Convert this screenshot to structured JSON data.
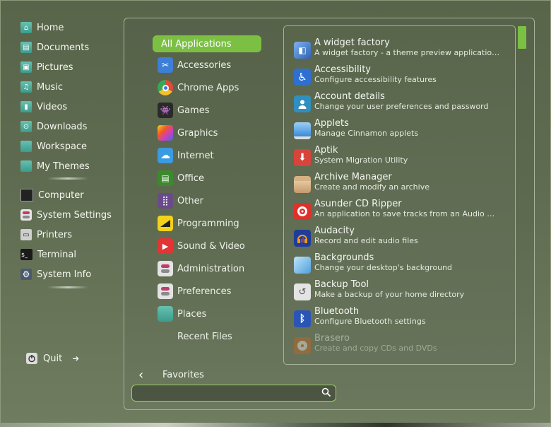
{
  "side": {
    "places": [
      {
        "label": "Home",
        "icon": "home-folder-icon"
      },
      {
        "label": "Documents",
        "icon": "documents-folder-icon"
      },
      {
        "label": "Pictures",
        "icon": "pictures-folder-icon"
      },
      {
        "label": "Music",
        "icon": "music-folder-icon"
      },
      {
        "label": "Videos",
        "icon": "videos-folder-icon"
      },
      {
        "label": "Downloads",
        "icon": "downloads-folder-icon"
      },
      {
        "label": "Workspace",
        "icon": "folder-icon"
      },
      {
        "label": "My Themes",
        "icon": "folder-icon"
      }
    ],
    "system": [
      {
        "label": "Computer",
        "icon": "computer-icon"
      },
      {
        "label": "System Settings",
        "icon": "settings-icon"
      },
      {
        "label": "Printers",
        "icon": "printer-icon"
      },
      {
        "label": "Terminal",
        "icon": "terminal-icon"
      },
      {
        "label": "System Info",
        "icon": "gear-icon"
      }
    ],
    "quit_label": "Quit"
  },
  "categories": [
    {
      "label": "All Applications",
      "active": true
    },
    {
      "label": "Accessories",
      "icon": "scissors-icon",
      "color": "#3d7fd6"
    },
    {
      "label": "Chrome Apps",
      "icon": "chrome-icon",
      "color": "#e04a3a"
    },
    {
      "label": "Games",
      "icon": "gamepad-icon",
      "color": "#2a2a2a"
    },
    {
      "label": "Graphics",
      "icon": "graphics-icon",
      "color": "#c93fbf"
    },
    {
      "label": "Internet",
      "icon": "cloud-icon",
      "color": "#3a9be0"
    },
    {
      "label": "Office",
      "icon": "office-icon",
      "color": "#3c8a2e"
    },
    {
      "label": "Other",
      "icon": "grid-icon",
      "color": "#6a4a8a"
    },
    {
      "label": "Programming",
      "icon": "programming-icon",
      "color": "#f2d21b"
    },
    {
      "label": "Sound & Video",
      "icon": "play-icon",
      "color": "#e23434"
    },
    {
      "label": "Administration",
      "icon": "toggle-icon",
      "color": "#d8d8d8"
    },
    {
      "label": "Preferences",
      "icon": "toggle-icon",
      "color": "#d8d8d8"
    },
    {
      "label": "Places",
      "icon": "folder-icon",
      "color": "#4db3a1"
    },
    {
      "label": "Recent Files"
    }
  ],
  "apps": [
    {
      "name": "A widget factory",
      "desc": "A widget factory - a theme preview applicatio…",
      "icon": "widget-factory-icon",
      "color": "#3b78c7"
    },
    {
      "name": "Accessibility",
      "desc": "Configure accessibility features",
      "icon": "accessibility-icon",
      "color": "#2f6fd0"
    },
    {
      "name": "Account details",
      "desc": "Change your user preferences and password",
      "icon": "user-icon",
      "color": "#2f8fbf"
    },
    {
      "name": "Applets",
      "desc": "Manage Cinnamon applets",
      "icon": "applets-icon",
      "color": "#5ea6e8"
    },
    {
      "name": "Aptik",
      "desc": "System Migration Utility",
      "icon": "aptik-icon",
      "color": "#d9443a"
    },
    {
      "name": "Archive Manager",
      "desc": "Create and modify an archive",
      "icon": "archive-icon",
      "color": "#d7b48a"
    },
    {
      "name": "Asunder CD Ripper",
      "desc": "An application to save tracks from an Audio …",
      "icon": "cd-ripper-icon",
      "color": "#e0302a"
    },
    {
      "name": "Audacity",
      "desc": "Record and edit audio files",
      "icon": "audacity-icon",
      "color": "#1f3c9a"
    },
    {
      "name": "Backgrounds",
      "desc": "Change your desktop's background",
      "icon": "backgrounds-icon",
      "color": "#79b9e8"
    },
    {
      "name": "Backup Tool",
      "desc": "Make a backup of your home directory",
      "icon": "backup-icon",
      "color": "#d9d9d9"
    },
    {
      "name": "Bluetooth",
      "desc": "Configure Bluetooth settings",
      "icon": "bluetooth-icon",
      "color": "#2a55b5"
    },
    {
      "name": "Brasero",
      "desc": "Create and copy CDs and DVDs",
      "icon": "brasero-icon",
      "color": "#c8641e",
      "faded": true
    }
  ],
  "favorites_label": "Favorites",
  "search": {
    "value": "",
    "placeholder": ""
  },
  "accent": "#7bc043"
}
